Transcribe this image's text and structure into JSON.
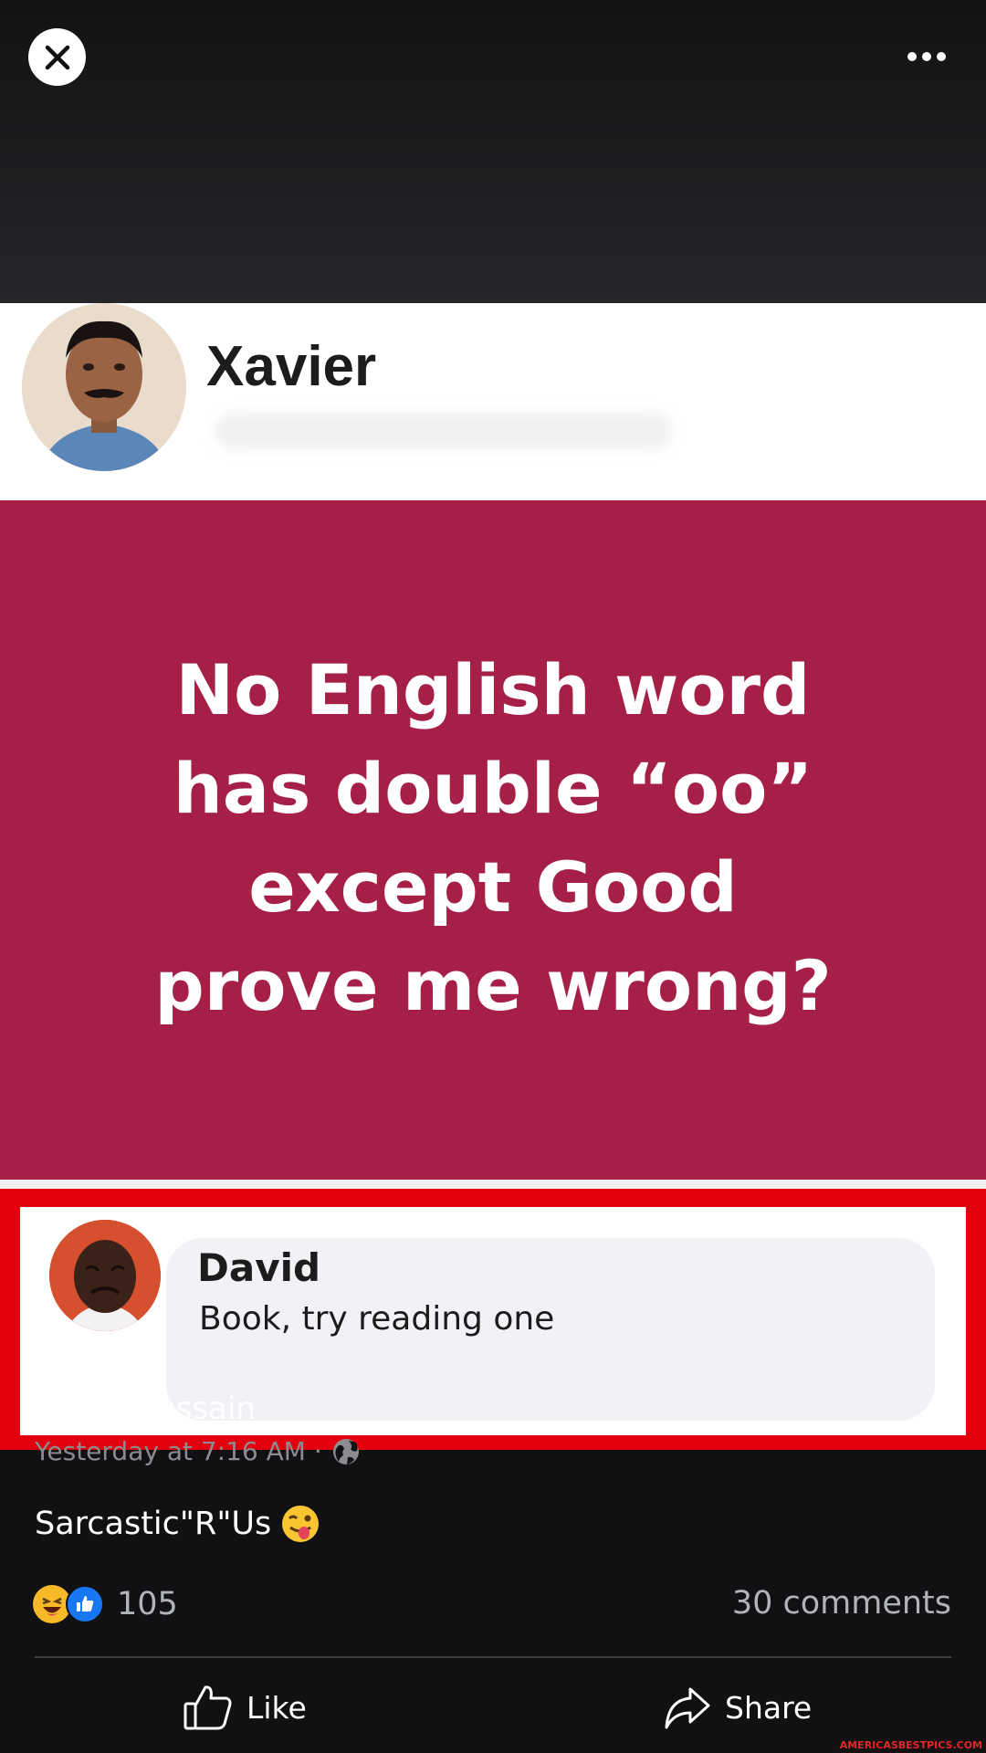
{
  "viewer": {
    "close_icon": "close-icon",
    "more_icon": "more-options-icon"
  },
  "image": {
    "author_name": "Xavier",
    "quote_lines": [
      "No English word",
      "has double “oo”",
      "except Good",
      "prove me wrong?"
    ],
    "background_color": "#a61f47",
    "comment": {
      "author": "David",
      "text": "Book, try reading one"
    }
  },
  "post": {
    "author": "Zahid Hussain",
    "timestamp": "Yesterday at 7:16 AM ·",
    "privacy_icon": "globe-icon",
    "caption": "Sarcastic\"R\"Us",
    "caption_emoji": "winking-tongue-emoji",
    "reaction_icons": [
      "haha-reaction-icon",
      "like-reaction-icon"
    ],
    "reaction_count": "105",
    "comments_count": "30 comments"
  },
  "actions": {
    "like_label": "Like",
    "share_label": "Share"
  },
  "watermark": "AMERICASBESTPICS.COM",
  "colors": {
    "like_blue": "#1877f2",
    "haha_yellow": "#f7b928",
    "frame_red": "#e3000e"
  }
}
